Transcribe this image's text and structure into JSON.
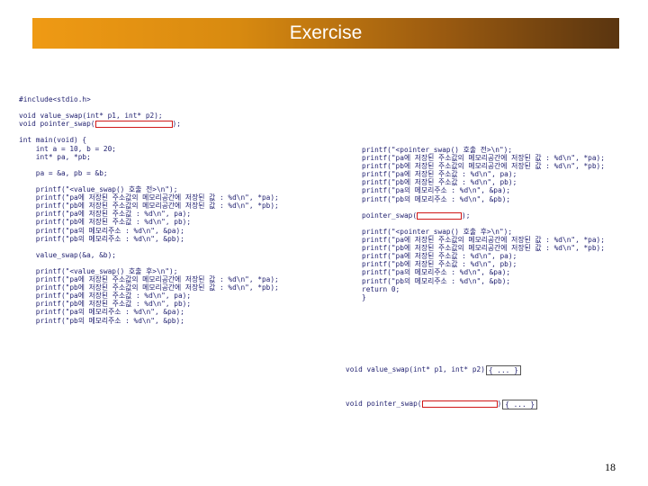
{
  "slide": {
    "title": "Exercise",
    "page_number": "18"
  },
  "code_left": [
    {
      "text": "#include<stdio.h>"
    },
    {
      "text": ""
    },
    {
      "text": "void value_swap(int* p1, int* p2);"
    },
    {
      "text": "void pointer_swap(",
      "blank_after": true,
      "rest": ");"
    },
    {
      "text": ""
    },
    {
      "text": "int main(void) {"
    },
    {
      "text": "    int a = 10, b = 20;"
    },
    {
      "text": "    int* pa, *pb;"
    },
    {
      "text": ""
    },
    {
      "text": "    pa = &a, pb = &b;"
    },
    {
      "text": ""
    },
    {
      "text": "    printf(\"<value_swap() 호출 전>\\n\");"
    },
    {
      "text": "    printf(\"pa에 저장된 주소값의 메모리공간에 저장된 값 : %d\\n\", *pa);"
    },
    {
      "text": "    printf(\"pb에 저장된 주소값의 메모리공간에 저장된 값 : %d\\n\", *pb);"
    },
    {
      "text": "    printf(\"pa에 저장된 주소값 : %d\\n\", pa);"
    },
    {
      "text": "    printf(\"pb에 저장된 주소값 : %d\\n\", pb);"
    },
    {
      "text": "    printf(\"pa의 메모리주소 : %d\\n\", &pa);"
    },
    {
      "text": "    printf(\"pb의 메모리주소 : %d\\n\", &pb);"
    },
    {
      "text": ""
    },
    {
      "text": "    value_swap(&a, &b);"
    },
    {
      "text": ""
    },
    {
      "text": "    printf(\"<value_swap() 호출 후>\\n\");"
    },
    {
      "text": "    printf(\"pa에 저장된 주소값의 메모리공간에 저장된 값 : %d\\n\", *pa);"
    },
    {
      "text": "    printf(\"pb에 저장된 주소값의 메모리공간에 저장된 값 : %d\\n\", *pb);"
    },
    {
      "text": "    printf(\"pa에 저장된 주소값 : %d\\n\", pa);"
    },
    {
      "text": "    printf(\"pb에 저장된 주소값 : %d\\n\", pb);"
    },
    {
      "text": "    printf(\"pa의 메모리주소 : %d\\n\", &pa);"
    },
    {
      "text": "    printf(\"pb의 메모리주소 : %d\\n\", &pb);"
    }
  ],
  "code_right": [
    {
      "text": "printf(\"<pointer_swap() 호출 전>\\n\");"
    },
    {
      "text": "printf(\"pa에 저장된 주소값의 메모리공간에 저장된 값 : %d\\n\", *pa);"
    },
    {
      "text": "printf(\"pb에 저장된 주소값의 메모리공간에 저장된 값 : %d\\n\", *pb);"
    },
    {
      "text": "printf(\"pa에 저장된 주소값 : %d\\n\", pa);"
    },
    {
      "text": "printf(\"pb에 저장된 주소값 : %d\\n\", pb);"
    },
    {
      "text": "printf(\"pa의 메모리주소 : %d\\n\", &pa);"
    },
    {
      "text": "printf(\"pb의 메모리주소 : %d\\n\", &pb);"
    },
    {
      "text": ""
    },
    {
      "text": "pointer_swap(",
      "blank_after": true,
      "rest": ");"
    },
    {
      "text": ""
    },
    {
      "text": "printf(\"<pointer_swap() 호출 후>\\n\");"
    },
    {
      "text": "printf(\"pa에 저장된 주소값의 메모리공간에 저장된 값 : %d\\n\", *pa);"
    },
    {
      "text": "printf(\"pb에 저장된 주소값의 메모리공간에 저장된 값 : %d\\n\", *pb);"
    },
    {
      "text": "printf(\"pa에 저장된 주소값 : %d\\n\", pa);"
    },
    {
      "text": "printf(\"pb에 저장된 주소값 : %d\\n\", pb);"
    },
    {
      "text": "printf(\"pa의 메모리주소 : %d\\n\", &pa);"
    },
    {
      "text": "printf(\"pb의 메모리주소 : %d\\n\", &pb);"
    },
    {
      "text": "return 0;"
    },
    {
      "text": "}"
    }
  ],
  "func_defs": [
    {
      "text": "void value_swap(int* p1, int* p2)",
      "box_label": "{ ... }"
    },
    {
      "text": "void pointer_swap(",
      "blank_after": true,
      "rest": ")",
      "box_label": "{ ... }"
    }
  ]
}
